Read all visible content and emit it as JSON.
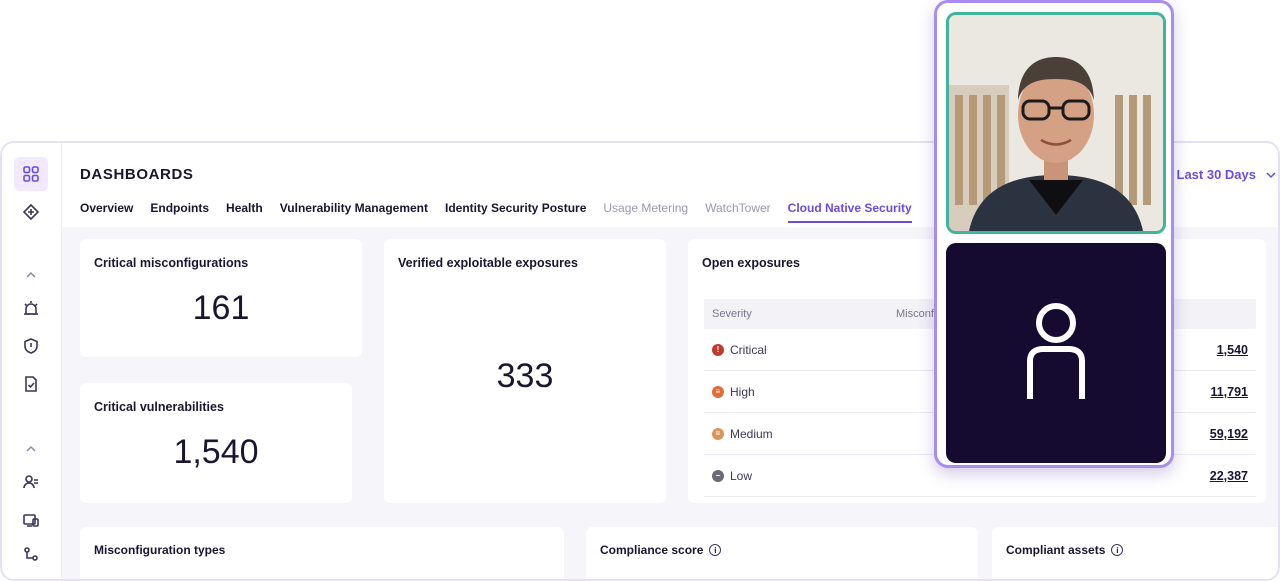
{
  "header": {
    "title": "DASHBOARDS",
    "date_range": "Last 30 Days"
  },
  "tabs": [
    {
      "label": "Overview",
      "state": "normal"
    },
    {
      "label": "Endpoints",
      "state": "normal"
    },
    {
      "label": "Health",
      "state": "normal"
    },
    {
      "label": "Vulnerability Management",
      "state": "normal"
    },
    {
      "label": "Identity Security Posture",
      "state": "normal"
    },
    {
      "label": "Usage Metering",
      "state": "dim"
    },
    {
      "label": "WatchTower",
      "state": "dim"
    },
    {
      "label": "Cloud Native Security",
      "state": "active"
    }
  ],
  "cards": {
    "critical_misconfigurations": {
      "title": "Critical misconfigurations",
      "value": "161"
    },
    "critical_vulnerabilities": {
      "title": "Critical vulnerabilities",
      "value": "1,540"
    },
    "verified_exposures": {
      "title": "Verified exploitable exposures",
      "value": "333"
    },
    "open_exposures": {
      "title": "Open exposures",
      "columns": [
        "Severity",
        "Misconf"
      ],
      "rows": [
        {
          "severity": "Critical",
          "value": "1,540",
          "color": "#c0392b"
        },
        {
          "severity": "High",
          "value": "11,791",
          "color": "#e06c3a"
        },
        {
          "severity": "Medium",
          "value": "59,192",
          "color": "#d9955a"
        },
        {
          "severity": "Low",
          "value": "22,387",
          "color": "#6b6b78"
        }
      ]
    }
  },
  "bottom": {
    "misconfiguration_types": "Misconfiguration types",
    "compliance_score": "Compliance score",
    "compliant_assets": "Compliant assets"
  },
  "colors": {
    "accent": "#6c4ce0",
    "video_border": "#a98cf0",
    "speaker_border": "#3fb59b",
    "avatar_bg": "#150b30"
  }
}
